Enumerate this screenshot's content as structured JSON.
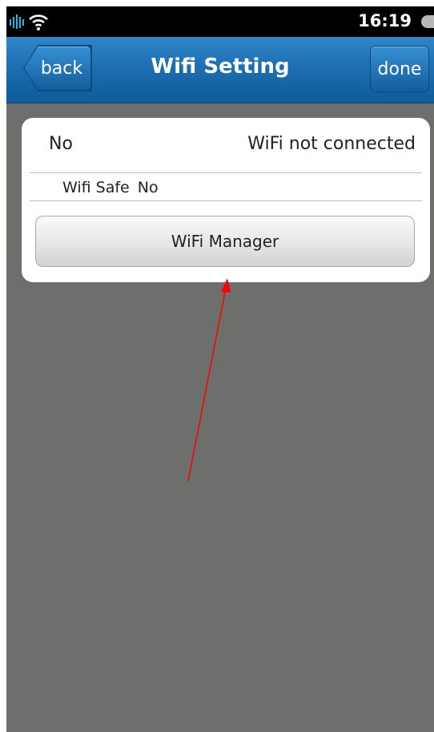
{
  "status_bar": {
    "time": "16:19",
    "icons": [
      "signal-icon",
      "wifi-icon",
      "battery-icon"
    ]
  },
  "header": {
    "back_label": "back",
    "title": "Wifi Setting",
    "done_label": "done"
  },
  "wifi_status": {
    "status_value": "No",
    "status_text": "WiFi not connected",
    "safe_label": "Wifi Safe",
    "safe_value": "No"
  },
  "actions": {
    "wifi_manager_label": "WiFi Manager"
  },
  "colors": {
    "title_bar": "#1d6fb2",
    "background": "#6e6e6c",
    "annotation_arrow": "#ff0000"
  }
}
